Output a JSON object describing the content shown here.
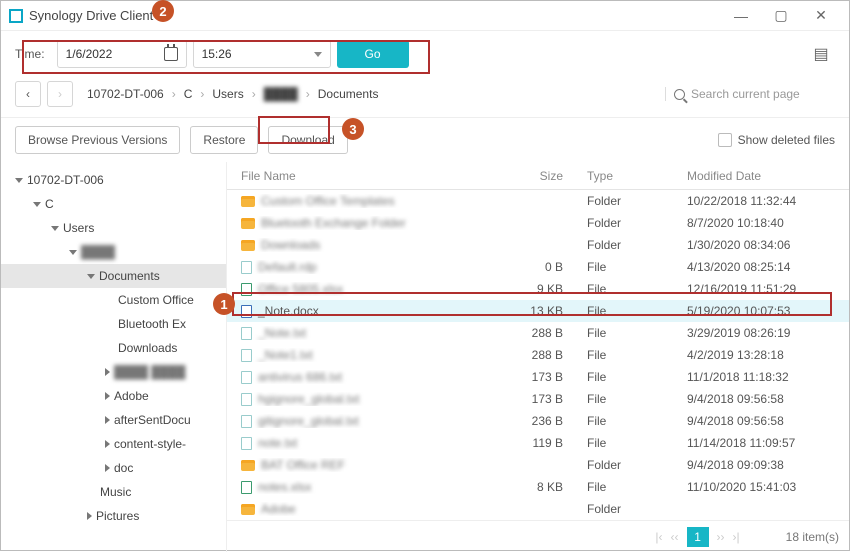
{
  "window": {
    "title": "Synology Drive Client"
  },
  "callouts": {
    "c1": "1",
    "c2": "2",
    "c3": "3"
  },
  "timebar": {
    "label": "Time:",
    "date": "1/6/2022",
    "time": "15:26",
    "go_label": "Go"
  },
  "breadcrumb": {
    "items": [
      "10702-DT-006",
      "C",
      "Users",
      "████",
      "Documents"
    ]
  },
  "search": {
    "placeholder": "Search current page"
  },
  "actions": {
    "browse": "Browse Previous Versions",
    "restore": "Restore",
    "download": "Download",
    "show_deleted": "Show deleted files"
  },
  "tree": {
    "items": [
      {
        "label": "10702-DT-006",
        "indent": 0,
        "expanded": true
      },
      {
        "label": "C",
        "indent": 1,
        "expanded": true
      },
      {
        "label": "Users",
        "indent": 2,
        "expanded": true
      },
      {
        "label": "████",
        "indent": 3,
        "expanded": true,
        "blur": true
      },
      {
        "label": "Documents",
        "indent": 4,
        "expanded": true,
        "selected": true
      },
      {
        "label": "Custom Office",
        "indent": 5,
        "leaf": true
      },
      {
        "label": "Bluetooth Ex",
        "indent": 5,
        "leaf": true
      },
      {
        "label": "Downloads",
        "indent": 5,
        "leaf": true
      },
      {
        "label": "████ ████",
        "indent": 5,
        "collapsed": true,
        "blur": true
      },
      {
        "label": "Adobe",
        "indent": 5,
        "collapsed": true
      },
      {
        "label": "afterSentDocu",
        "indent": 5,
        "collapsed": true
      },
      {
        "label": "content-style-",
        "indent": 5,
        "collapsed": true
      },
      {
        "label": "doc",
        "indent": 5,
        "collapsed": true
      },
      {
        "label": "Music",
        "indent": 4,
        "leaf": true
      },
      {
        "label": "Pictures",
        "indent": 4,
        "collapsed": true
      }
    ]
  },
  "table": {
    "headers": {
      "name": "File Name",
      "size": "Size",
      "type": "Type",
      "date": "Modified Date"
    },
    "rows": [
      {
        "icon": "folder",
        "name": "Custom Office Templates",
        "size": "",
        "type": "Folder",
        "date": "10/22/2018 11:32:44",
        "blur": true
      },
      {
        "icon": "folder",
        "name": "Bluetooth Exchange Folder",
        "size": "",
        "type": "Folder",
        "date": "8/7/2020 10:18:40",
        "blur": true
      },
      {
        "icon": "folder",
        "name": "Downloads",
        "size": "",
        "type": "Folder",
        "date": "1/30/2020 08:34:06",
        "blur": true
      },
      {
        "icon": "file",
        "name": "Default.rdp",
        "size": "0 B",
        "type": "File",
        "date": "4/13/2020 08:25:14",
        "blur": true
      },
      {
        "icon": "fxls",
        "name": "Office 5805.xlsx",
        "size": "9 KB",
        "type": "File",
        "date": "12/16/2019 11:51:29",
        "blur": true
      },
      {
        "icon": "fdoc",
        "name": "_Note.docx",
        "size": "13 KB",
        "type": "File",
        "date": "5/19/2020 10:07:53",
        "selected": true,
        "blur": false
      },
      {
        "icon": "file",
        "name": "_Note.txt",
        "size": "288 B",
        "type": "File",
        "date": "3/29/2019 08:26:19",
        "blur": true
      },
      {
        "icon": "file",
        "name": "_Note1.txt",
        "size": "288 B",
        "type": "File",
        "date": "4/2/2019 13:28:18",
        "blur": true
      },
      {
        "icon": "file",
        "name": "antivirus 686.txt",
        "size": "173 B",
        "type": "File",
        "date": "11/1/2018 11:18:32",
        "blur": true
      },
      {
        "icon": "file",
        "name": "hgignore_global.txt",
        "size": "173 B",
        "type": "File",
        "date": "9/4/2018 09:56:58",
        "blur": true
      },
      {
        "icon": "file",
        "name": "gitignore_global.txt",
        "size": "236 B",
        "type": "File",
        "date": "9/4/2018 09:56:58",
        "blur": true
      },
      {
        "icon": "file",
        "name": "note.txt",
        "size": "119 B",
        "type": "File",
        "date": "11/14/2018 11:09:57",
        "blur": true
      },
      {
        "icon": "folder",
        "name": "BAT Office REF",
        "size": "",
        "type": "Folder",
        "date": "9/4/2018 09:09:38",
        "blur": true
      },
      {
        "icon": "fxls",
        "name": "notes.xlsx",
        "size": "8 KB",
        "type": "File",
        "date": "11/10/2020 15:41:03",
        "blur": true
      },
      {
        "icon": "folder",
        "name": "Adobe",
        "size": "",
        "type": "Folder",
        "date": "",
        "blur": true
      }
    ]
  },
  "pager": {
    "page": "1",
    "total": "18 item(s)"
  }
}
